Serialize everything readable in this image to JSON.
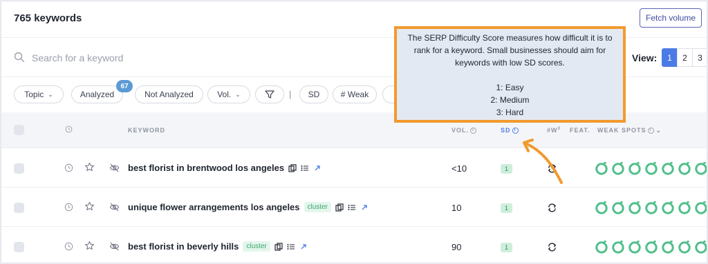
{
  "header": {
    "title": "765 keywords",
    "fetch_label": "Fetch volume"
  },
  "search": {
    "placeholder": "Search for a keyword",
    "value": ""
  },
  "view": {
    "label": "View:",
    "options": [
      "1",
      "2",
      "3"
    ],
    "selected": "1"
  },
  "filters": {
    "topic": "Topic",
    "analyzed": "Analyzed",
    "analyzed_count": "67",
    "not_analyzed": "Not Analyzed",
    "vol": "Vol.",
    "separator": "|",
    "sd": "SD",
    "weak": "# Weak"
  },
  "table": {
    "columns": {
      "keyword": "KEYWORD",
      "vol": "VOL.",
      "sd": "SD",
      "weak_count": "#W",
      "weak_sup": "3",
      "feat": "FEAT.",
      "weak_spots": "WEAK SPOTS"
    },
    "rows": [
      {
        "keyword": "best florist in brentwood los angeles",
        "cluster": "",
        "vol": "<10",
        "sd": "1"
      },
      {
        "keyword": "unique flower arrangements los angeles",
        "cluster": "cluster",
        "vol": "10",
        "sd": "1"
      },
      {
        "keyword": "best florist in beverly hills",
        "cluster": "cluster",
        "vol": "90",
        "sd": "1"
      }
    ]
  },
  "tooltip": {
    "text": "The SERP Difficulty Score measures how difficult it is to\nrank for a keyword. Small businesses should aim for\nkeywords with low SD scores.",
    "levels": [
      "1: Easy",
      "2: Medium",
      "3: Hard"
    ]
  },
  "colors": {
    "accent": "#4b7be5",
    "highlight_border": "#f19a2d",
    "sd_badge": "#cdeedb",
    "weak_spot": "#4fbf8b"
  }
}
